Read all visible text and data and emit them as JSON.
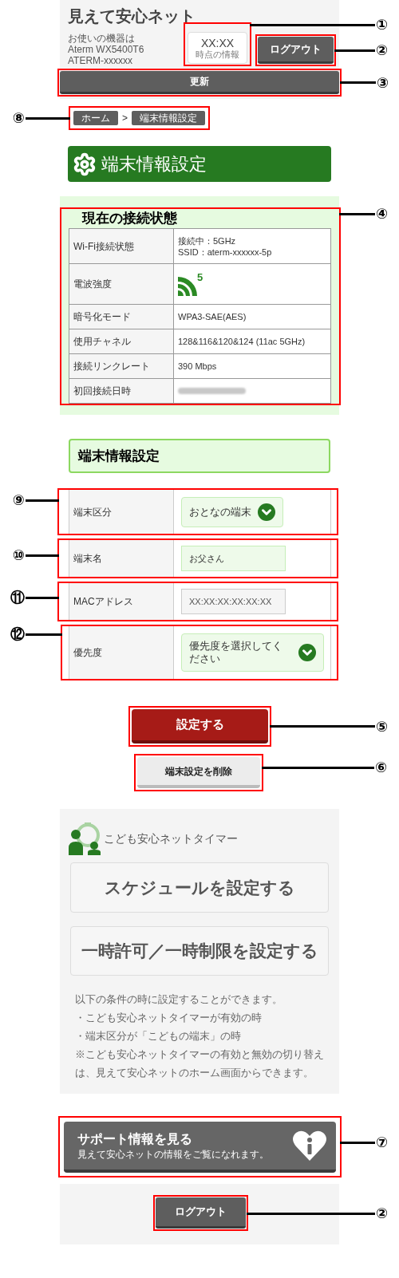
{
  "header": {
    "title": "見えて安心ネット",
    "device_lines": [
      "お使いの機器は",
      "Aterm WX5400T6",
      "ATERM-xxxxxx"
    ],
    "time_box": {
      "time": "XX:XX",
      "caption": "時点の情報",
      "callout": "①"
    },
    "logout_button": {
      "label": "ログアウト",
      "callout": "②"
    },
    "refresh_button": {
      "label": "更新",
      "callout": "③"
    }
  },
  "breadcrumb": {
    "callout": "⑧",
    "separator": ">",
    "items": [
      {
        "label": "ホーム"
      },
      {
        "label": "端末情報設定"
      }
    ]
  },
  "page_title": "端末情報設定",
  "connection": {
    "callout": "④",
    "title": "現在の接続状態",
    "rows": [
      {
        "kind": "text",
        "label": "Wi-Fi接続状態",
        "lines": [
          "接続中：5GHz",
          "SSID：aterm-xxxxxx-5p"
        ]
      },
      {
        "kind": "signal",
        "label": "電波強度",
        "band": "5"
      },
      {
        "kind": "text",
        "label": "暗号化モード",
        "lines": [
          "WPA3-SAE(AES)"
        ]
      },
      {
        "kind": "text",
        "label": "使用チャネル",
        "lines": [
          "128&116&120&124 (11ac 5GHz)"
        ]
      },
      {
        "kind": "text",
        "label": "接続リンクレート",
        "lines": [
          "390 Mbps"
        ]
      },
      {
        "kind": "blurred",
        "label": "初回接続日時"
      }
    ]
  },
  "settings": {
    "title": "端末情報設定",
    "rows": [
      {
        "kind": "select",
        "label": "端末区分",
        "value": "おとなの端末",
        "callout": "⑨"
      },
      {
        "kind": "input",
        "label": "端末名",
        "value": "お父さん",
        "disabled": false,
        "callout": "⑩"
      },
      {
        "kind": "input",
        "label": "MACアドレス",
        "value": "XX:XX:XX:XX:XX:XX",
        "disabled": true,
        "callout": "⑪"
      },
      {
        "kind": "select",
        "label": "優先度",
        "value": "優先度を選択してください",
        "callout": "⑫"
      }
    ]
  },
  "save_button": {
    "label": "設定する",
    "callout": "⑤"
  },
  "delete_button": {
    "label": "端末設定を削除",
    "callout": "⑥"
  },
  "timer": {
    "title": "こども安心ネットタイマー",
    "buttons": [
      "スケジュールを設定する",
      "一時許可／一時制限を設定する"
    ],
    "notes": [
      "以下の条件の時に設定することができます。",
      "・こども安心ネットタイマーが有効の時",
      "・端末区分が「こどもの端末」の時",
      "※こども安心ネットタイマーの有効と無効の切り替えは、見えて安心ネットのホーム画面からできます。"
    ]
  },
  "support": {
    "title": "サポート情報を見る",
    "subtitle": "見えて安心ネットの情報をご覧になれます。",
    "callout": "⑦"
  },
  "footer_logout": {
    "label": "ログアウト",
    "callout": "②"
  }
}
